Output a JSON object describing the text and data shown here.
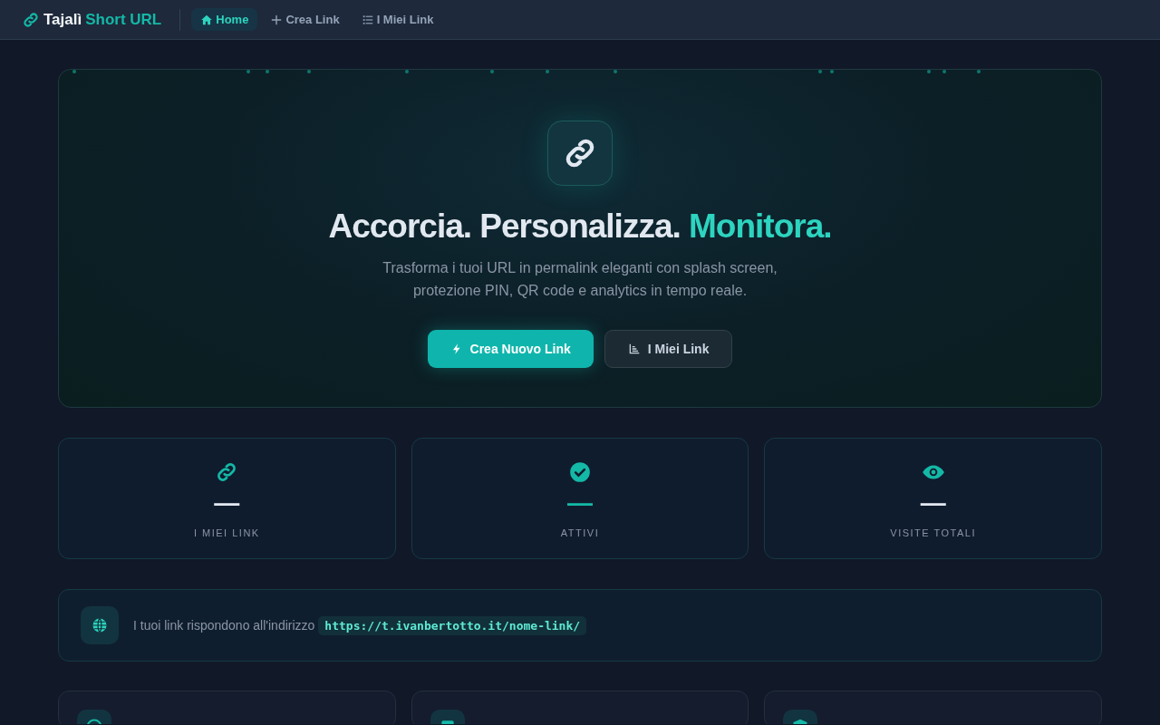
{
  "navbar": {
    "brand": {
      "name": "Tajalì",
      "accent": "Short URL"
    },
    "links": [
      {
        "label": "Home",
        "selected": true
      },
      {
        "label": "Crea Link",
        "selected": false
      },
      {
        "label": "I Miei Link",
        "selected": false
      }
    ]
  },
  "hero": {
    "title": "Accorcia. Personalizza.",
    "title_accent": "Monitora.",
    "subtitle": "Trasforma i tuoi URL in permalink eleganti con splash screen, protezione PIN, QR code e analytics in tempo reale.",
    "buttons": [
      {
        "label": "Crea Nuovo Link",
        "kind": "primary"
      },
      {
        "label": "I Miei Link",
        "kind": "secondary"
      }
    ]
  },
  "stats": [
    {
      "value": "—",
      "label": "I MIEI LINK",
      "accent": false
    },
    {
      "value": "—",
      "label": "ATTIVI",
      "accent": true
    },
    {
      "value": "—",
      "label": "VISITE TOTALI",
      "accent": false
    }
  ],
  "domain_notice": {
    "text": "I tuoi link rispondono all'indirizzo",
    "url": "https://t.ivanbertotto.it/nome-link/"
  }
}
